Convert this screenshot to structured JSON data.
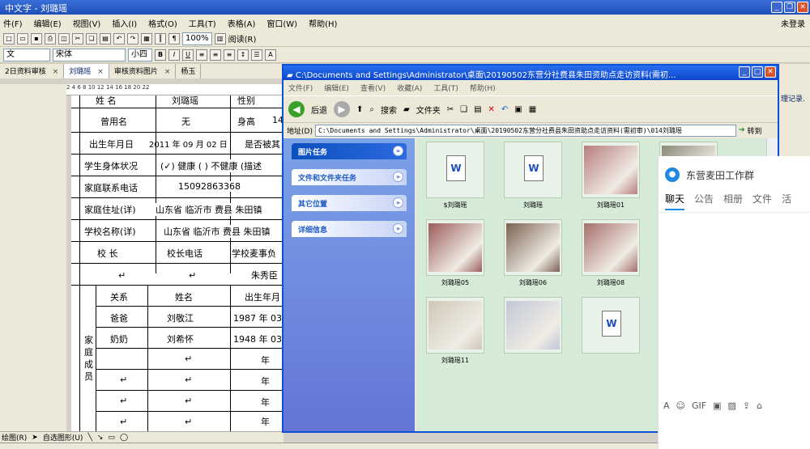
{
  "word": {
    "title": "中文字 - 刘璐瑶",
    "menu": [
      "件(F)",
      "编辑(E)",
      "视图(V)",
      "插入(I)",
      "格式(O)",
      "工具(T)",
      "表格(A)",
      "窗口(W)",
      "帮助(H)"
    ],
    "login": "未登录",
    "style_sel": "文",
    "font_sel": "宋体",
    "size_sel": "小四",
    "zoom": "100%",
    "read_btn": "阅读(R)",
    "tabs": [
      {
        "label": "2日资料审核",
        "close": "×"
      },
      {
        "label": "刘璐瑶",
        "close": "×"
      },
      {
        "label": "审核资料图片",
        "close": "×"
      },
      {
        "label": "杨玉"
      }
    ],
    "ruler": "2   4   6   8   10  12  14  16  18  20  22",
    "side_text": "理记录."
  },
  "doc": {
    "rows": [
      {
        "a": "姓  名",
        "b": "刘璐瑶",
        "c": "性别"
      },
      {
        "a": "曾用名",
        "b": "无",
        "c": "身高",
        "d": "14"
      },
      {
        "a": "出生年月日",
        "b": "2011 年 09 月 02 日",
        "c": "是否被其"
      },
      {
        "a": "学生身体状况",
        "b": "(✓) 健康 ( ) 不健康 (描述"
      },
      {
        "a": "家庭联系电话",
        "b": "15092863368"
      },
      {
        "a": "家庭住址(详)",
        "b": "山东省 临沂市 费县 朱田镇"
      },
      {
        "a": "学校名称(详)",
        "b": "山东省 临沂市 费县 朱田镇"
      },
      {
        "a": "校  长",
        "b": "校长电话",
        "c": "学校麦事负"
      },
      {
        "a": "",
        "b": "",
        "c": "朱秀臣"
      }
    ],
    "family_label": "家庭成员",
    "family_header": {
      "rel": "关系",
      "name": "姓名",
      "birth": "出生年月"
    },
    "family": [
      {
        "rel": "爸爸",
        "name": "刘敬江",
        "birth": "1987 年 03"
      },
      {
        "rel": "奶奶",
        "name": "刘希怀",
        "birth": "1948 年 03"
      },
      {
        "rel": "",
        "name": "",
        "birth": "年"
      },
      {
        "rel": "",
        "name": "",
        "birth": "年"
      },
      {
        "rel": "",
        "name": "",
        "birth": "年"
      },
      {
        "rel": "",
        "name": "",
        "birth": "年"
      }
    ],
    "mark": "↵"
  },
  "drawbar": {
    "draw": "绘图(R)",
    "autoshape": "自选图形(U)"
  },
  "explorer": {
    "title": "C:\\Documents and Settings\\Administrator\\桌面\\20190502东营分社费县朱田资助点走访资料(需初...",
    "menu": [
      "文件(F)",
      "编辑(E)",
      "查看(V)",
      "收藏(A)",
      "工具(T)",
      "帮助(H)"
    ],
    "back": "后退",
    "search": "搜索",
    "folders": "文件夹",
    "address_label": "地址(D)",
    "address": "C:\\Documents and Settings\\Administrator\\桌面\\20190502东营分社费县朱田资助点走访资料(需初审)\\014刘璐瑶",
    "go": "转到",
    "tasks": [
      "图片任务",
      "文件和文件夹任务",
      "其它位置",
      "详细信息"
    ],
    "files": [
      {
        "name": "$刘璐瑶",
        "kind": "doc"
      },
      {
        "name": "刘璐瑶",
        "kind": "doc"
      },
      {
        "name": "刘璐瑶01",
        "kind": "photo",
        "color": "#b77d7d"
      },
      {
        "name": "刘璐瑶04",
        "kind": "photo",
        "color": "#8c8a7a"
      },
      {
        "name": "刘璐瑶05",
        "kind": "photo",
        "color": "#9b5c5a"
      },
      {
        "name": "刘璐瑶06",
        "kind": "photo",
        "color": "#7c6252"
      },
      {
        "name": "刘璐瑶08",
        "kind": "photo",
        "color": "#a4706a"
      },
      {
        "name": "刘璐瑶09",
        "kind": "photo",
        "color": "#c45a4a"
      },
      {
        "name": "刘璐瑶11",
        "kind": "photo",
        "color": "#cfc8b8"
      },
      {
        "name": "",
        "kind": "photo",
        "color": "#c2c8d8"
      },
      {
        "name": "",
        "kind": "doc"
      }
    ]
  },
  "qq": {
    "group": "东营麦田工作群",
    "tabs": [
      "聊天",
      "公告",
      "相册",
      "文件",
      "活"
    ],
    "tools": [
      "A",
      "☺",
      "GIF",
      "▣",
      "▨",
      "⇪",
      "⌂"
    ]
  }
}
